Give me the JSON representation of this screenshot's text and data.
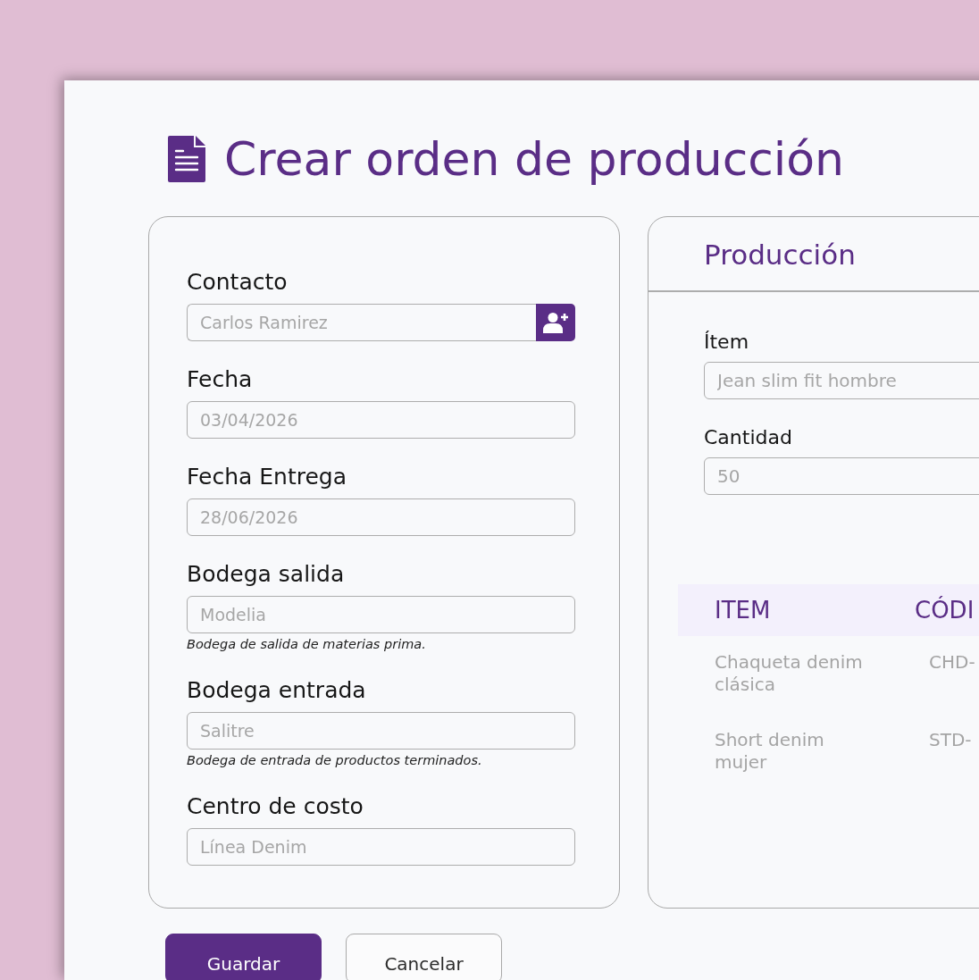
{
  "title": "Crear orden de producción",
  "general": {
    "fields": [
      {
        "kind": "contact",
        "label": "Contacto",
        "placeholder": "Carlos Ramirez"
      },
      {
        "kind": "text",
        "label": "Fecha",
        "placeholder": "03/04/2026"
      },
      {
        "kind": "text",
        "label": "Fecha Entrega",
        "placeholder": "28/06/2026"
      },
      {
        "kind": "text",
        "label": "Bodega salida",
        "placeholder": "Modelia",
        "hint": "Bodega de salida de materias prima."
      },
      {
        "kind": "text",
        "label": "Bodega entrada",
        "placeholder": "Salitre",
        "hint": "Bodega de entrada de productos terminados."
      },
      {
        "kind": "text",
        "label": "Centro de costo",
        "placeholder": "Línea Denim"
      }
    ]
  },
  "production": {
    "title": "Producción",
    "fields": [
      {
        "label": "Ítem",
        "placeholder": "Jean slim fit hombre"
      },
      {
        "label": "Cantidad",
        "placeholder": "50"
      }
    ],
    "table": {
      "columns": [
        "ITEM",
        "CÓDI"
      ],
      "rows": [
        [
          "Chaqueta denim clásica",
          "CHD-"
        ],
        [
          "Short denim mujer",
          "STD-"
        ]
      ]
    }
  },
  "buttons": [
    {
      "kind": "primary",
      "label": "Guardar"
    },
    {
      "kind": "secondary",
      "label": "Cancelar"
    }
  ]
}
